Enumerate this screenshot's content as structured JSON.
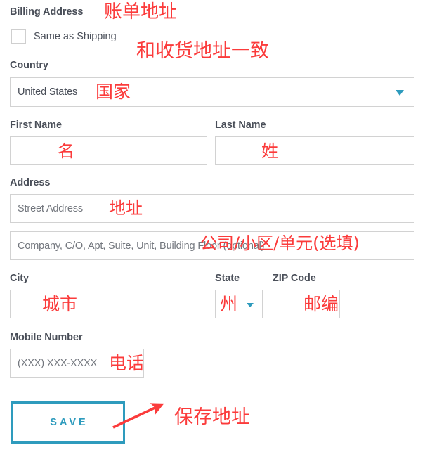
{
  "section": {
    "title": "Billing Address"
  },
  "checkbox": {
    "label": "Same as Shipping",
    "checked": false
  },
  "fields": {
    "country": {
      "label": "Country",
      "value": "United States",
      "chevron_icon": "chevron-down-icon"
    },
    "first_name": {
      "label": "First Name",
      "value": "",
      "placeholder": ""
    },
    "last_name": {
      "label": "Last Name",
      "value": "",
      "placeholder": ""
    },
    "address": {
      "label": "Address",
      "line1_placeholder": "Street Address",
      "line2_placeholder": "Company, C/O, Apt, Suite, Unit, Building Floor (optional)"
    },
    "city": {
      "label": "City",
      "value": "",
      "placeholder": ""
    },
    "state": {
      "label": "State",
      "value": "",
      "chevron_icon": "chevron-down-icon"
    },
    "zip": {
      "label": "ZIP Code",
      "value": "",
      "placeholder": ""
    },
    "mobile": {
      "label": "Mobile Number",
      "placeholder": "(XXX) XXX-XXXX"
    }
  },
  "save_button": {
    "label": "SAVE"
  },
  "annotations": {
    "billing_address": "账单地址",
    "same_as_shipping": "和收货地址一致",
    "country": "国家",
    "first_name": "名",
    "last_name": "姓",
    "address": "地址",
    "address_line2": "公司/小区/单元(选填)",
    "city": "城市",
    "state": "州",
    "zip": "邮编",
    "mobile": "电话",
    "save": "保存地址"
  },
  "colors": {
    "accent_teal": "#2e9bbd",
    "annotation_red": "#fb3b3b",
    "label_gray": "#4a4f59",
    "border_gray": "#d2d2d2",
    "placeholder_gray": "#73777e"
  }
}
